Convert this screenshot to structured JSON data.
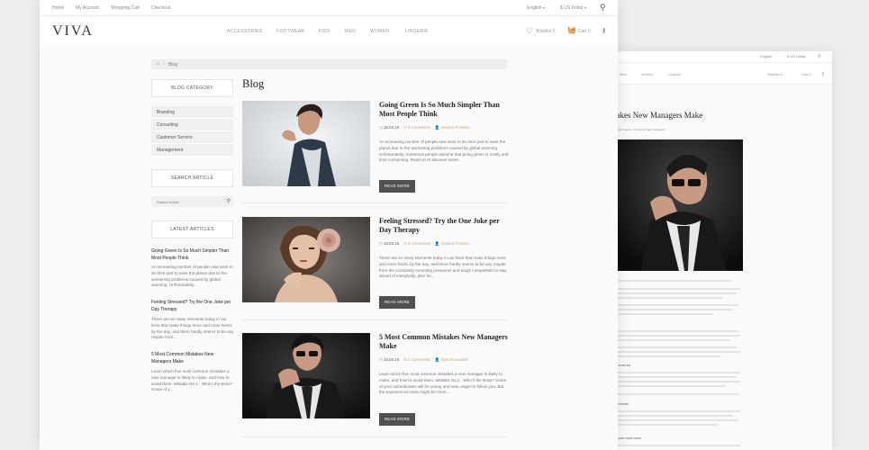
{
  "colors": {
    "accent": "#c8a078",
    "button": "#505050",
    "band": "#fafafa"
  },
  "topbar": {
    "links": [
      "Home",
      "My Account",
      "Shopping Cart",
      "Checkout"
    ],
    "language": "English",
    "currency": "$ US Dollar"
  },
  "header": {
    "logo": "VIVA",
    "nav": [
      "Accessories",
      "Footwear",
      "Kids",
      "Men",
      "Women",
      "Lingerie"
    ],
    "wishlist": "Wishlist 0",
    "cart": "Cart 0"
  },
  "breadcrumb": {
    "current": "Blog"
  },
  "sidebar": {
    "category_title": "Blog Category",
    "categories": [
      "Branding",
      "Consulting",
      "Customer Service",
      "Management"
    ],
    "search_title": "Search Article",
    "search_placeholder": "Search Article",
    "latest_title": "Latest Articles",
    "latest": [
      {
        "title": "Going Green Is So Much Simpler Than Most People Think",
        "excerpt": "An increasing number of people now want to do their part to save the planet due to the worsening problems caused by global warming. Unfortunately..."
      },
      {
        "title": "Feeling Stressed? Try the One Joke per Day Therapy",
        "excerpt": "There are so many elements today in our lives that make things more and more hectic by the day, and there hardly seems to be any respite from..."
      },
      {
        "title": "5 Most Common Mistakes New Managers Make",
        "excerpt": "Learn which five most common mistakes a new manager is likely to make, and how to avoid them. Mistake No 1 - Who's the Boss? Some of y..."
      }
    ]
  },
  "main": {
    "title": "Blog",
    "read_more": "Read More",
    "posts": [
      {
        "title": "Going Green Is So Much Simpler Than Most People Think",
        "date": "15.04.16",
        "comments": "3 Comments",
        "author": "Jessica Princton",
        "excerpt": "An increasing number of people now want to do their part to save the planet due to the worsening problems caused by global warming. Unfortunately, numerous people assume that going green is costly and time consuming. Read on to discover sever..."
      },
      {
        "title": "Feeling Stressed? Try the One Joke per Day Therapy",
        "date": "15.04.16",
        "comments": "3 Comments",
        "author": "Jessica Princton",
        "excerpt": "There are so many elements today in our lives that make things more and more hectic by the day, and there hardly seems to be any respite from the constantly mounting pressures and tough competition to stay ahead of everybody, plan for..."
      },
      {
        "title": "5 Most Common Mistakes New Managers Make",
        "date": "15.04.16",
        "comments": "3 Comments",
        "author": "Sam Kronsdam",
        "excerpt": "Learn which five most common mistakes a new manager is likely to make, and how to avoid them. Mistake No.1 - Who's the Boss? Some of your subordinates will be young and new, eager to follow you. But, the experienced ones might be more..."
      }
    ]
  },
  "detail": {
    "language": "English",
    "currency": "$ US Dollar",
    "nav": [
      "Men",
      "Women",
      "Lingerie"
    ],
    "wishlist": "Wishlist 0",
    "cart": "Cart 0",
    "title": "takes New Managers Make",
    "comments": "3 Comments",
    "posted_by": "Posted by Sam Kronsdam",
    "headings": [
      "IY",
      "IBLE RULES",
      "RUCTIONS",
      "LF AND YOUR TEAM"
    ]
  }
}
